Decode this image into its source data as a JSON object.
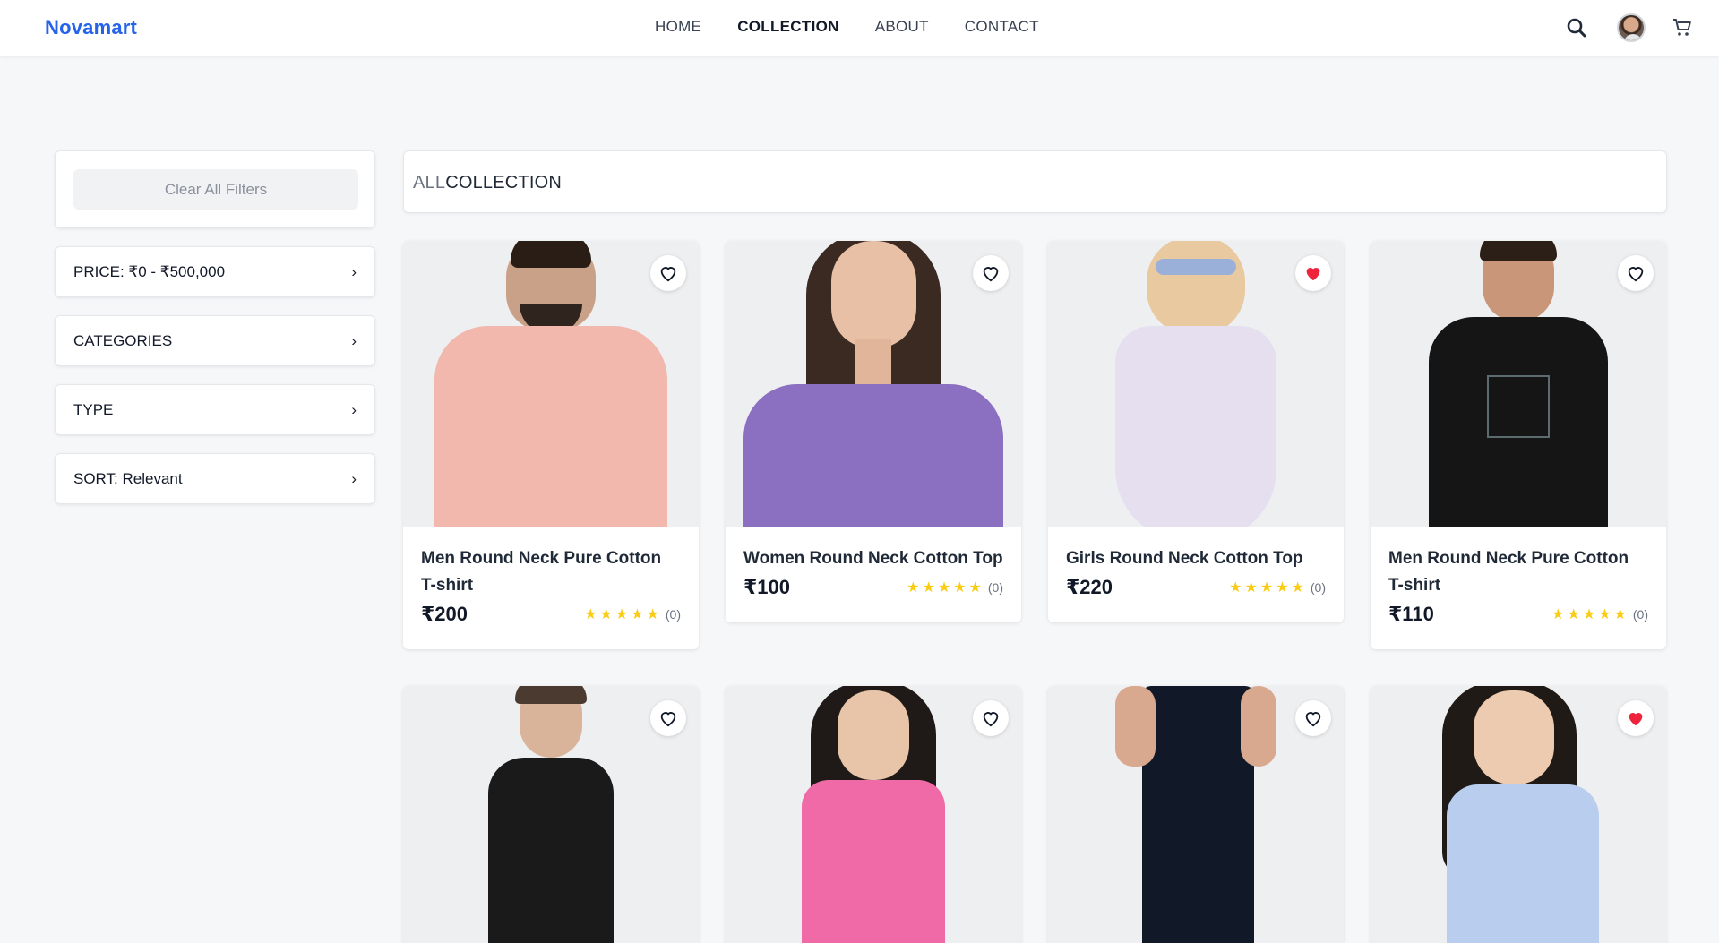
{
  "brand": {
    "name": "Novamart",
    "color": "#2563eb"
  },
  "nav": [
    {
      "label": "HOME",
      "active": false
    },
    {
      "label": "COLLECTION",
      "active": true
    },
    {
      "label": "ABOUT",
      "active": false
    },
    {
      "label": "CONTACT",
      "active": false
    }
  ],
  "header_icons": {
    "search": "search-icon",
    "avatar": "avatar",
    "cart": "cart-icon"
  },
  "sidebar": {
    "clear_label": "Clear All Filters",
    "filters": [
      {
        "label": "PRICE: ₹0 - ₹500,000"
      },
      {
        "label": "CATEGORIES"
      },
      {
        "label": "TYPE"
      },
      {
        "label": "SORT: Relevant"
      }
    ]
  },
  "collection_title": {
    "prefix": "ALL",
    "main": "COLLECTION"
  },
  "products": [
    {
      "name": "Men Round Neck Pure Cotton T-shirt",
      "price": "₹200",
      "rating_count": "(0)",
      "favorited": false,
      "shirt_color": "#f2b7ad"
    },
    {
      "name": "Women Round Neck Cotton Top",
      "price": "₹100",
      "rating_count": "(0)",
      "favorited": false,
      "shirt_color": "#8b6fc0"
    },
    {
      "name": "Girls Round Neck Cotton Top",
      "price": "₹220",
      "rating_count": "(0)",
      "favorited": true,
      "shirt_color": "#e6dff0"
    },
    {
      "name": "Men Round Neck Pure Cotton T-shirt",
      "price": "₹110",
      "rating_count": "(0)",
      "favorited": false,
      "shirt_color": "#151515"
    },
    {
      "favorited": false,
      "shirt_color": "#1a1a1a"
    },
    {
      "favorited": false,
      "shirt_color": "#f06aa8"
    },
    {
      "favorited": false,
      "shirt_color": "#111827"
    },
    {
      "favorited": true,
      "shirt_color": "#b9cdee"
    }
  ],
  "rating_stars": "★★★★★",
  "colors": {
    "heart_active": "#ef233c",
    "star": "#facc15"
  }
}
